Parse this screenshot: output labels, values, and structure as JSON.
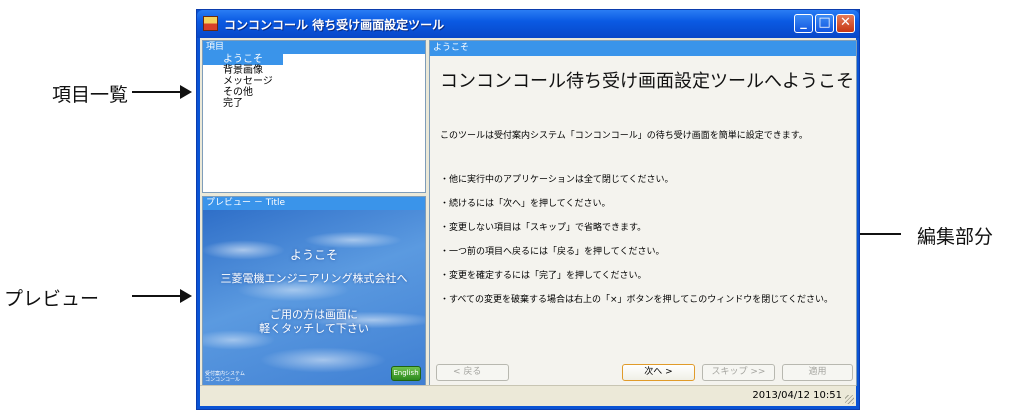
{
  "callouts": {
    "item_list": "項目一覧",
    "preview": "プレビュー",
    "edit_area": "編集部分"
  },
  "window": {
    "title": "コンコンコール 待ち受け画面設定ツール",
    "min_label": "_",
    "max_label": "□",
    "close_label": "✕"
  },
  "items_panel": {
    "header": "項目",
    "items": [
      "ようこそ",
      "背景画像",
      "メッセージ",
      "その他",
      "完了"
    ],
    "selected_index": 0
  },
  "preview_panel": {
    "header": "プレビュー － Title",
    "line1": "ようこそ",
    "line2": "三菱電機エンジニアリング株式会社へ",
    "line3": "ご用の方は画面に",
    "line4": "軽くタッチして下さい",
    "small_line1": "受付案内システム",
    "small_line2": "コンコンコール",
    "english_button": "English"
  },
  "main_panel": {
    "header": "ようこそ",
    "title": "コンコンコール待ち受け画面設定ツールへようこそ",
    "intro": "このツールは受付案内システム「コンコンコール」の待ち受け画面を簡単に設定できます。",
    "bullets": [
      "・他に実行中のアプリケーションは全て閉じてください。",
      "・続けるには「次へ」を押してください。",
      "・変更しない項目は「スキップ」で省略できます。",
      "・一つ前の項目へ戻るには「戻る」を押してください。",
      "・変更を確定するには「完了」を押してください。",
      "・すべての変更を破棄する場合は右上の「×」ボタンを押してこのウィンドウを閉じてください。"
    ],
    "buttons": {
      "back": "< 戻る",
      "next": "次へ >",
      "skip": "スキップ >>",
      "apply": "適用"
    }
  },
  "statusbar": {
    "datetime": "2013/04/12  10:51"
  },
  "colors": {
    "titlebar": "#0a5ae3",
    "panel_header": "#3a94ea",
    "next_border": "#e09b2a"
  }
}
